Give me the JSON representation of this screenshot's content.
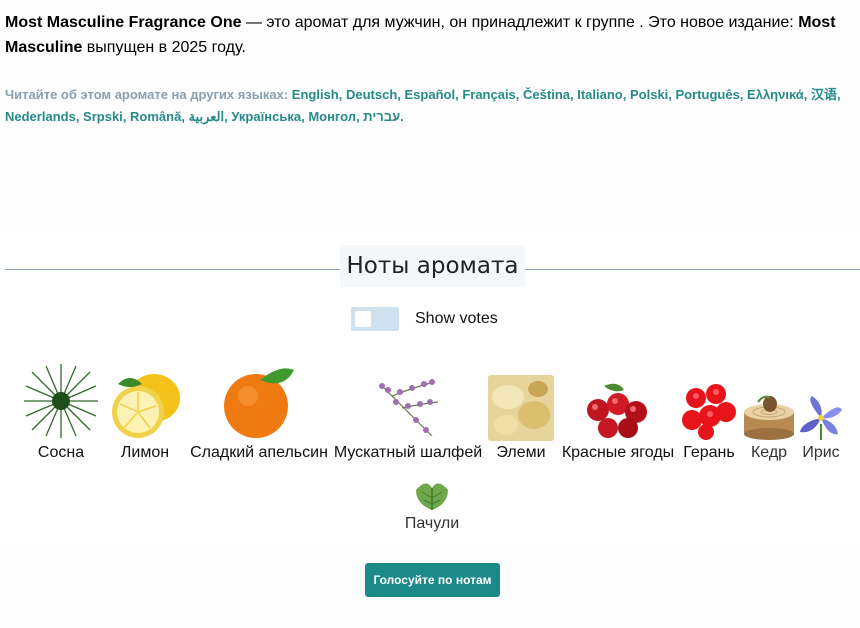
{
  "intro": {
    "perfume_name": "Most Masculine Fragrance One",
    "text_1": " — это аромат для мужчин, он принадлежит к группе . Это новое издание: ",
    "brand": "Most Masculine",
    "text_2": " выпущен в 2025 году."
  },
  "languages": {
    "prefix": "Читайте об этом аромате на других языках: ",
    "items": [
      "English",
      "Deutsch",
      "Español",
      "Français",
      "Čeština",
      "Italiano",
      "Polski",
      "Português",
      "Ελληνικά",
      "汉语",
      "Nederlands",
      "Srpski",
      "Română",
      "العربية",
      "Українська",
      "Монгол",
      "עברית"
    ],
    "end": "."
  },
  "notes_section": {
    "heading": "Ноты аромата",
    "show_votes_label": "Show votes",
    "vote_button": "Голосуйте по нотам",
    "notes": [
      {
        "name": "Сосна",
        "icon": "pine-icon"
      },
      {
        "name": "Лимон",
        "icon": "lemon-icon"
      },
      {
        "name": "Сладкий апельсин",
        "icon": "orange-icon"
      },
      {
        "name": "Мускатный шалфей",
        "icon": "sage-icon"
      },
      {
        "name": "Элеми",
        "icon": "elemi-icon"
      },
      {
        "name": "Красные ягоды",
        "icon": "berries-icon"
      },
      {
        "name": "Герань",
        "icon": "geranium-icon"
      },
      {
        "name": "Кедр",
        "icon": "cedar-icon"
      },
      {
        "name": "Ирис",
        "icon": "iris-icon"
      },
      {
        "name": "Пачули",
        "icon": "patchouli-icon"
      }
    ]
  }
}
